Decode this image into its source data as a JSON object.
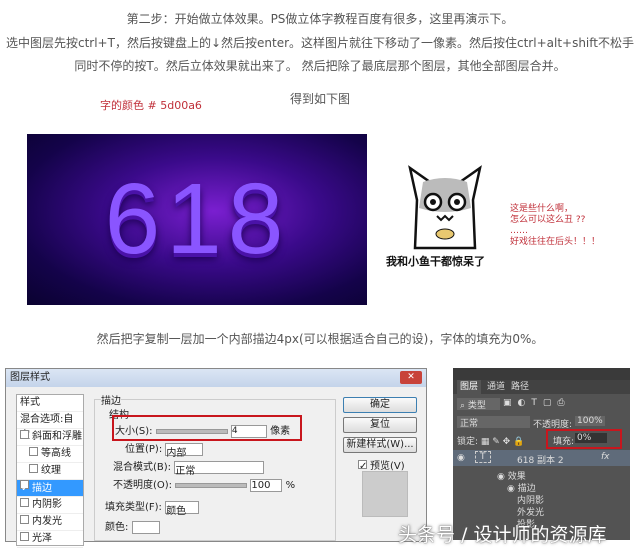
{
  "article": {
    "line1": "第二步：开始做立体效果。PS做立体字教程百度有很多，这里再演示下。",
    "line2": "选中图层先按ctrl+T，然后按键盘上的↓然后按enter。这样图片就往下移动了一像素。然后按住ctrl+alt+shift不松手",
    "line3": "同时不停的按T。然后立体效果就出来了。 然后把除了最底层那个图层，其他全部图层合并。",
    "color_note": "字的颜色 # 5d00a6",
    "result_note": "得到如下图",
    "hero_text": "618",
    "meme_caption": "我和小鱼干都惊呆了",
    "meme_side1": "这是些什么啊，",
    "meme_side2": "怎么可以这么丑 ??",
    "meme_side3": "……",
    "meme_side4": "好戏往往在后头！！！",
    "line4": "然后把字复制一层加一个内部描边4px(可以根据适合自己的设)，字体的填充为0%。"
  },
  "dialog": {
    "title": "图层样式",
    "styles": [
      "样式",
      "混合选项:自定",
      "斜面和浮雕",
      "等高线",
      "纹理",
      "描边",
      "内阴影",
      "内发光",
      "光泽"
    ],
    "group": "描边",
    "sub": "结构",
    "size_label": "大小(S):",
    "size_value": "4",
    "unit": "像素",
    "position_label": "位置(P):",
    "position_value": "内部",
    "blend_label": "混合模式(B):",
    "blend_value": "正常",
    "opacity_label": "不透明度(O):",
    "opacity_value": "100",
    "pct": "%",
    "fill_type_label": "填充类型(F):",
    "fill_type_value": "颜色",
    "color_label": "颜色:",
    "ok": "确定",
    "reset": "复位",
    "new_style": "新建样式(W)...",
    "preview": "预览(V)"
  },
  "layers": {
    "tabs": [
      "图层",
      "通道",
      "路径"
    ],
    "kind": "类型",
    "mode": "正常",
    "opacity_label": "不透明度:",
    "opacity": "100%",
    "lock_label": "锁定:",
    "fill_label": "填充:",
    "fill": "0%",
    "layer_name": "618 副本 2",
    "fx": "fx",
    "effects": "效果",
    "effect_items": [
      "描边",
      "内阴影",
      "外发光",
      "投影"
    ]
  },
  "watermark": "头条号 / 设计师的资源库",
  "colors": {
    "text_color": "#5d00a6",
    "highlight": "#c8161d"
  }
}
